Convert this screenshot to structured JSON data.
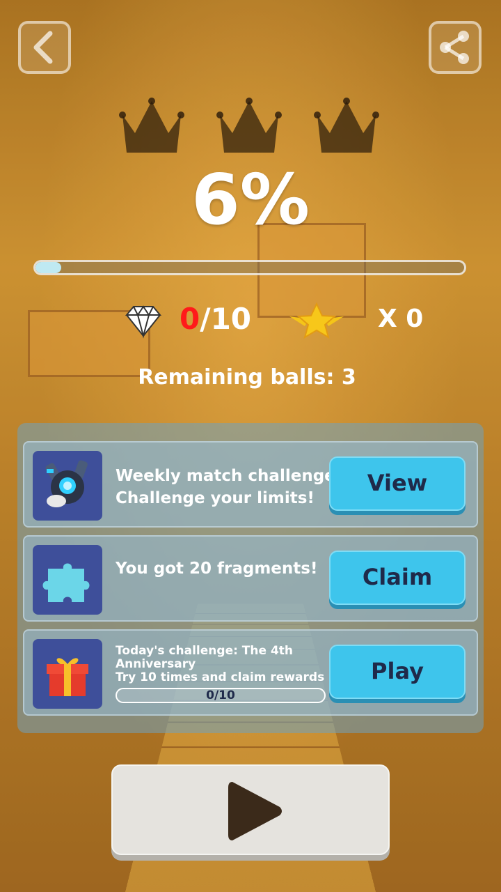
{
  "hud": {
    "back_icon": "back-arrow-icon",
    "share_icon": "share-icon",
    "crowns": [
      {
        "icon": "crown-icon",
        "earned": false
      },
      {
        "icon": "crown-icon",
        "earned": false
      },
      {
        "icon": "crown-icon",
        "earned": false
      }
    ]
  },
  "result": {
    "percent_label": "6%",
    "progress_fraction": 0.06
  },
  "stats": {
    "gems_collected": "0",
    "gems_total": "/10",
    "stars_label": "X 0",
    "diamond_icon": "diamond-icon",
    "star_icon": "winged-star-icon"
  },
  "remaining_balls": "Remaining balls: 3",
  "cards": [
    {
      "icon": "robot-character-icon",
      "line1": "Weekly match challenge",
      "line2": "Challenge your limits!",
      "button": "View"
    },
    {
      "icon": "puzzle-piece-icon",
      "line1": "You got 20 fragments!",
      "button": "Claim"
    },
    {
      "icon": "gift-box-icon",
      "line1": "Today's challenge: The 4th",
      "line2": "Anniversary",
      "line3": "Try 10 times and claim rewards",
      "progress": "0/10",
      "button": "Play"
    }
  ],
  "play_icon": "play-icon",
  "colors": {
    "cta": "#3ec5ec",
    "gem_count_red": "#ff1a1a",
    "thumb_bg": "#3e4f9a"
  }
}
